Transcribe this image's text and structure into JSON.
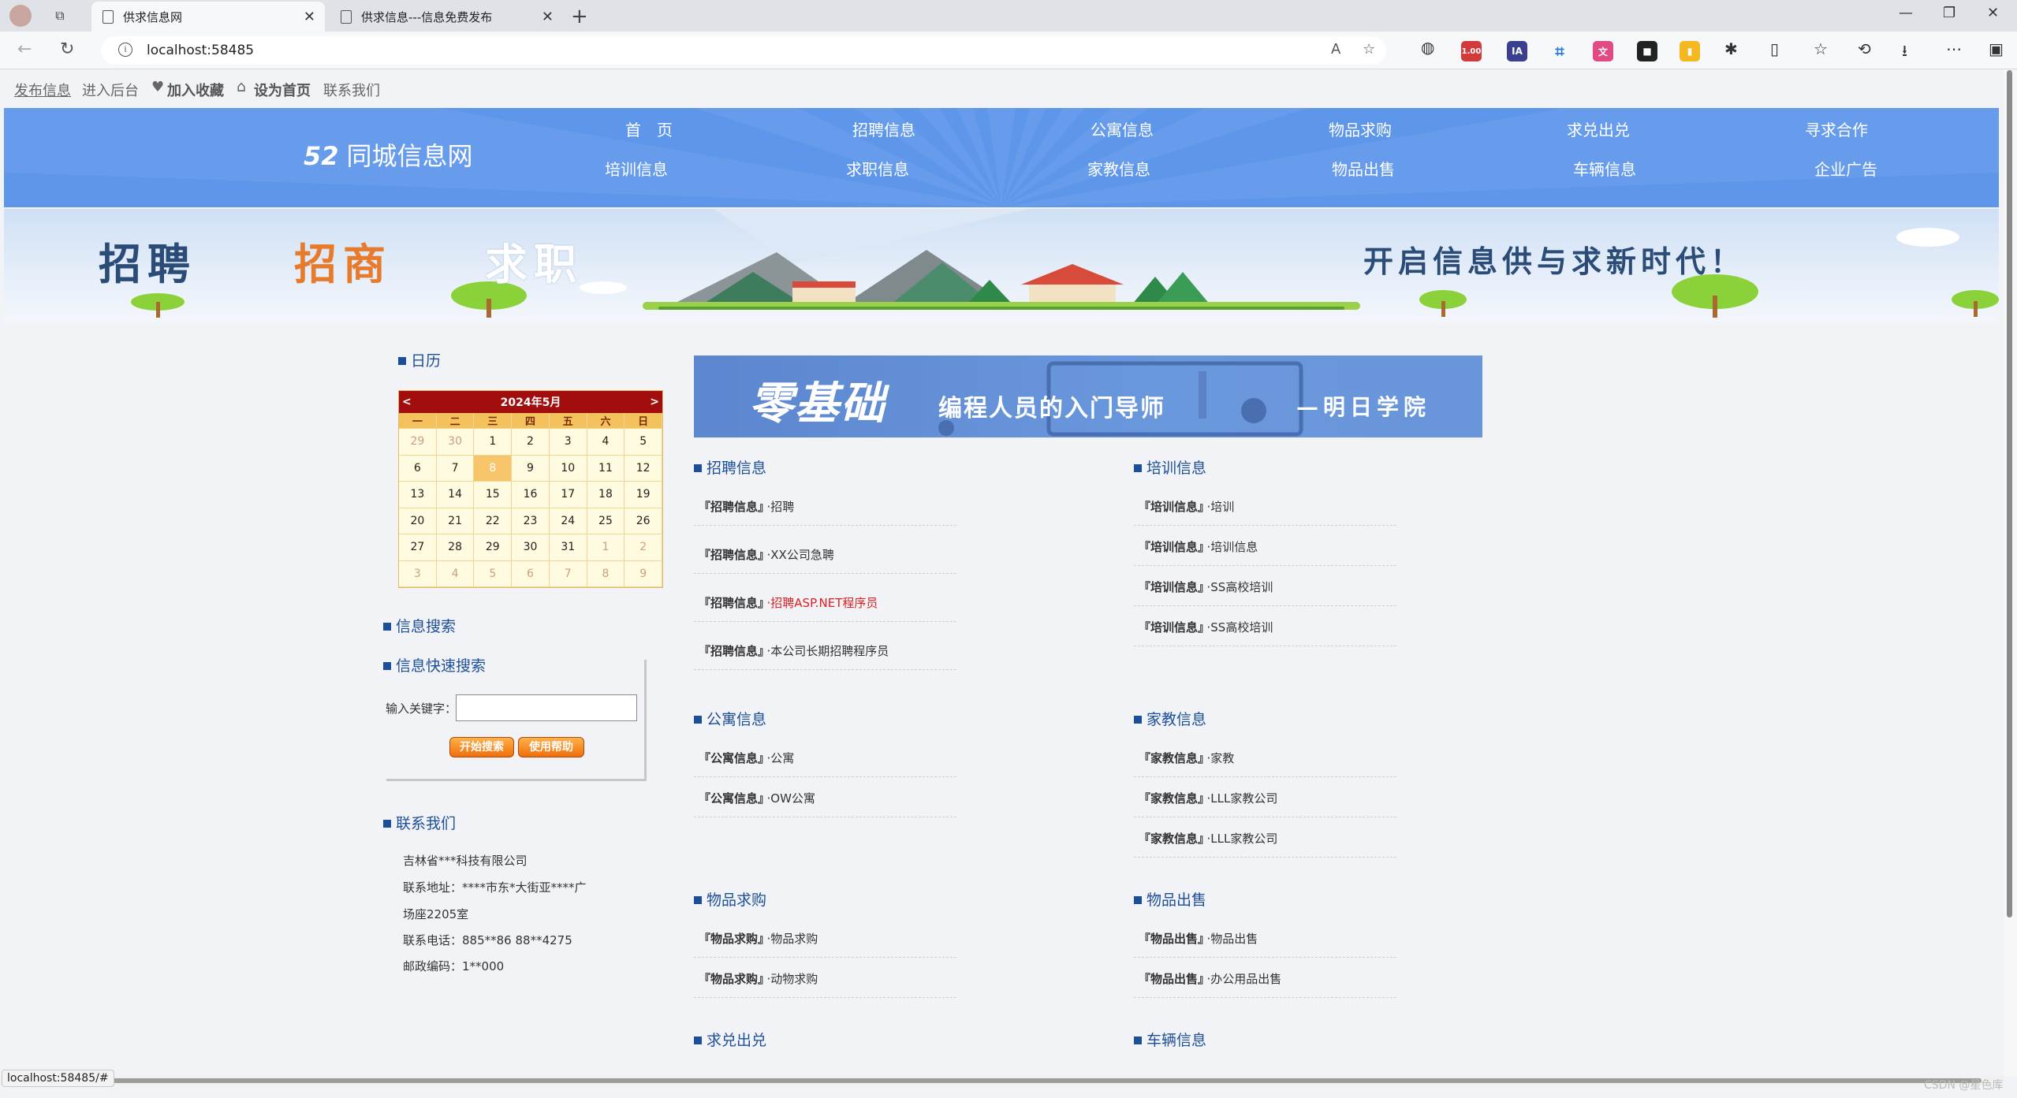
{
  "browser": {
    "tabs": [
      {
        "label": "供求信息网"
      },
      {
        "label": "供求信息---信息免费发布"
      }
    ],
    "url": "localhost:58485",
    "ext_badge": "1.00",
    "status_url": "localhost:58485/#"
  },
  "topbar": {
    "links": [
      "发布信息",
      "进入后台",
      "加入收藏",
      "设为首页",
      "联系我们"
    ]
  },
  "header": {
    "logo_num": "52",
    "logo_text": "同城信息网",
    "menu": [
      "首　页",
      "招聘信息",
      "公寓信息",
      "物品求购",
      "求兑出兑",
      "寻求合作",
      "培训信息",
      "求职信息",
      "家教信息",
      "物品出售",
      "车辆信息",
      "企业广告"
    ]
  },
  "banner": {
    "w1": "招聘",
    "w2": "招商",
    "w3": "求职",
    "slogan": "开启信息供与求新时代！"
  },
  "calendar": {
    "title": "日历",
    "month": "2024年5月",
    "prev": "<",
    "next": ">",
    "weekdays": [
      "一",
      "二",
      "三",
      "四",
      "五",
      "六",
      "日"
    ],
    "weeks": [
      [
        "29",
        "30",
        "1",
        "2",
        "3",
        "4",
        "5"
      ],
      [
        "6",
        "7",
        "8",
        "9",
        "10",
        "11",
        "12"
      ],
      [
        "13",
        "14",
        "15",
        "16",
        "17",
        "18",
        "19"
      ],
      [
        "20",
        "21",
        "22",
        "23",
        "24",
        "25",
        "26"
      ],
      [
        "27",
        "28",
        "29",
        "30",
        "31",
        "1",
        "2"
      ],
      [
        "3",
        "4",
        "5",
        "6",
        "7",
        "8",
        "9"
      ]
    ],
    "today": "8"
  },
  "search": {
    "title": "信息搜索",
    "quick_title": "信息快速搜索",
    "label": "输入关键字：",
    "value": "",
    "btn_search": "开始搜索",
    "btn_help": "使用帮助"
  },
  "contact": {
    "title": "联系我们",
    "lines": [
      "吉林省***科技有限公司",
      "联系地址：****市东*大街亚****广",
      "场座2205室",
      "联系电话：885**86 88**4275",
      "邮政编码：1**000"
    ]
  },
  "ad": {
    "t1": "零基础",
    "t2": "编程人员的入门导师",
    "t3": "—明日学院"
  },
  "sections": {
    "zhaopin": {
      "title": "招聘信息",
      "items": [
        {
          "cat": "『招聘信息』",
          "text": "·招聘"
        },
        {
          "cat": "『招聘信息』",
          "text": "·XX公司急聘"
        },
        {
          "cat": "『招聘信息』",
          "text": "·招聘ASP.NET程序员"
        },
        {
          "cat": "『招聘信息』",
          "text": "·本公司长期招聘程序员"
        }
      ]
    },
    "peixun": {
      "title": "培训信息",
      "items": [
        {
          "cat": "『培训信息』",
          "text": "·培训"
        },
        {
          "cat": "『培训信息』",
          "text": "·培训信息"
        },
        {
          "cat": "『培训信息』",
          "text": "·SS高校培训"
        },
        {
          "cat": "『培训信息』",
          "text": "·SS高校培训"
        }
      ]
    },
    "gongyu": {
      "title": "公寓信息",
      "items": [
        {
          "cat": "『公寓信息』",
          "text": "·公寓"
        },
        {
          "cat": "『公寓信息』",
          "text": "·OW公寓"
        }
      ]
    },
    "jiajiao": {
      "title": "家教信息",
      "items": [
        {
          "cat": "『家教信息』",
          "text": "·家教"
        },
        {
          "cat": "『家教信息』",
          "text": "·LLL家教公司"
        },
        {
          "cat": "『家教信息』",
          "text": "·LLL家教公司"
        }
      ]
    },
    "qiugou": {
      "title": "物品求购",
      "items": [
        {
          "cat": "『物品求购』",
          "text": "·物品求购"
        },
        {
          "cat": "『物品求购』",
          "text": "·动物求购"
        }
      ]
    },
    "chushou": {
      "title": "物品出售",
      "items": [
        {
          "cat": "『物品出售』",
          "text": "·物品出售"
        },
        {
          "cat": "『物品出售』",
          "text": "·办公用品出售"
        }
      ]
    },
    "qiudui": {
      "title": "求兑出兑"
    },
    "cheliang": {
      "title": "车辆信息"
    }
  },
  "watermark": "CSDN @星色库"
}
